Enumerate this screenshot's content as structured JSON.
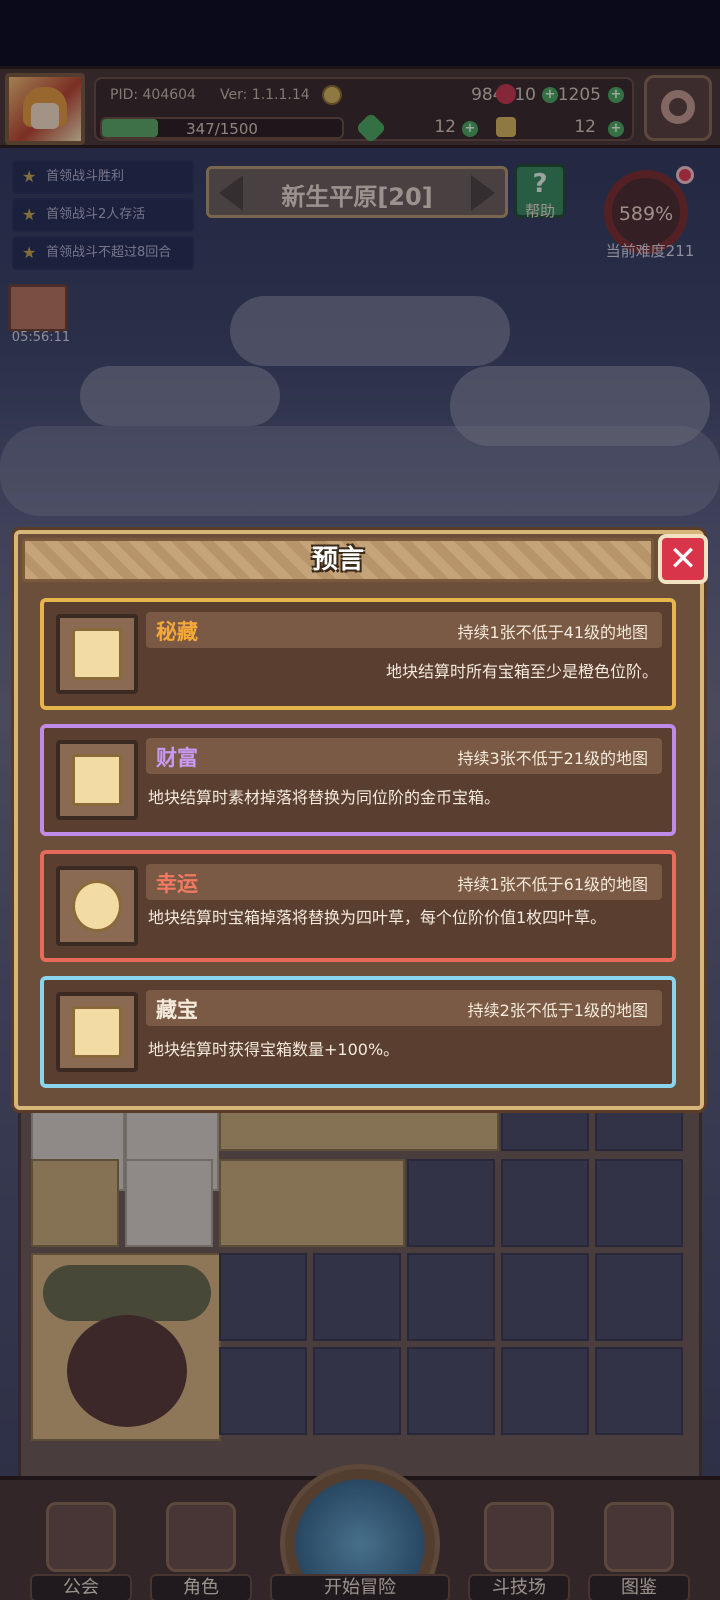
{
  "header": {
    "pid": "PID: 404604",
    "version": "Ver: 1.1.1.14",
    "gold": "984310",
    "gems": "1205",
    "exp": "347/1500",
    "exp_fraction": 0.2313,
    "clovers": "12",
    "keys": "12"
  },
  "quests": [
    {
      "label": "首领战斗胜利"
    },
    {
      "label": "首领战斗2人存活"
    },
    {
      "label": "首领战斗不超过8回合"
    }
  ],
  "chest_timer": "05:56:11",
  "location": {
    "name": "新生平原[20]",
    "help_label": "帮助"
  },
  "difficulty": {
    "percent": "589%",
    "label": "当前难度211"
  },
  "dialog": {
    "title": "预言",
    "cards": [
      {
        "name": "秘藏",
        "duration": "持续1张不低于41级的地图",
        "desc": "地块结算时所有宝箱至少是橙色位阶。",
        "icon": "scroll-icon",
        "color": "#e6b64a"
      },
      {
        "name": "财富",
        "duration": "持续3张不低于21级的地图",
        "desc": "地块结算时素材掉落将替换为同位阶的金币宝箱。",
        "icon": "coin-stack-icon",
        "color": "#c08ae8"
      },
      {
        "name": "幸运",
        "duration": "持续1张不低于61级的地图",
        "desc": "地块结算时宝箱掉落将替换为四叶草，每个位阶价值1枚四叶草。",
        "icon": "clover-icon",
        "color": "#e86a5a"
      },
      {
        "name": "藏宝",
        "duration": "持续2张不低于1级的地图",
        "desc": "地块结算时获得宝箱数量+100%。",
        "icon": "scroll-icon",
        "color": "#8ad4ee"
      }
    ]
  },
  "nav": {
    "guild": "公会",
    "character": "角色",
    "adventure": "开始冒险",
    "arena": "斗技场",
    "codex": "图鉴"
  }
}
